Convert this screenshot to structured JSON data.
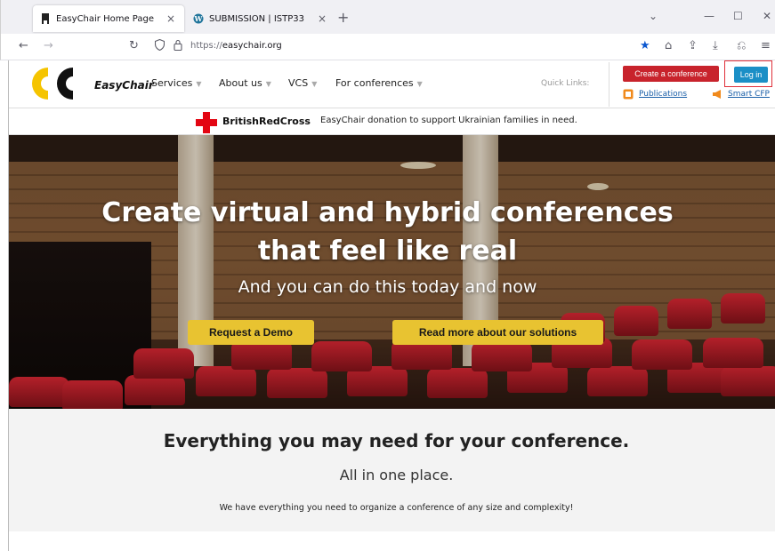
{
  "browser": {
    "tabs": [
      {
        "title": "EasyChair Home Page",
        "icon": "easychair-favicon-icon",
        "active": true
      },
      {
        "title": "SUBMISSION | ISTP33",
        "icon": "wordpress-icon",
        "active": false
      }
    ],
    "new_tab": "+",
    "url_scheme": "https://",
    "url_host": "easychair.org",
    "close_glyph": "×"
  },
  "header": {
    "logo_text": "EasyChair",
    "menu": [
      {
        "label": "Services"
      },
      {
        "label": "About us"
      },
      {
        "label": "VCS"
      },
      {
        "label": "For conferences"
      }
    ],
    "quick_links_label": "Quick Links:",
    "create_conference": "Create a conference",
    "login": "Log in",
    "publications": "Publications",
    "smart_cfp": "Smart CFP",
    "colors": {
      "red": "#c8232c",
      "blue": "#1b8fc6",
      "logo_yellow": "#f5c400"
    }
  },
  "donation": {
    "org": "BritishRedCross",
    "text": "EasyChair donation to support Ukrainian families in need."
  },
  "hero": {
    "title_line1": "Create virtual and hybrid conferences",
    "title_line2": "that feel like real",
    "subtitle": "And you can do this today and now",
    "button_demo": "Request a Demo",
    "button_solutions": "Read more about our solutions",
    "button_color": "#e8c331"
  },
  "features": {
    "title": "Everything you may need for your conference.",
    "subtitle": "All in one place.",
    "description": "We have everything you need to organize a conference of any size and complexity!"
  }
}
